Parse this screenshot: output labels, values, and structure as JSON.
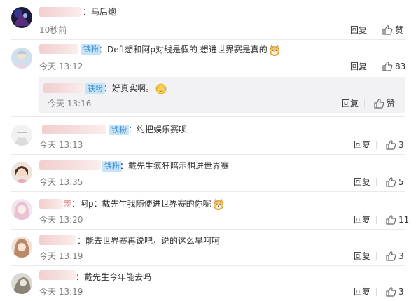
{
  "comments": [
    {
      "text": "马后炮",
      "time": "10秒前",
      "reply": "回复",
      "like": "赞"
    },
    {
      "badge": "铁粉",
      "text": "Deft想和阿p对线是假的 想进世界赛是真的",
      "time": "今天 13:12",
      "reply": "回复",
      "like": "83"
    },
    {
      "badge": "铁粉",
      "text": "好真实啊。",
      "time": "今天 13:16",
      "reply": "回复",
      "like": "赞"
    },
    {
      "badge": "铁粉",
      "text": "约把娱乐赛呗",
      "time": "今天 13:13",
      "reply": "回复",
      "like": "3"
    },
    {
      "badge": "铁粉",
      "text": "戴先生疯狂暗示想进世界赛",
      "time": "今天 13:35",
      "reply": "回复",
      "like": "5"
    },
    {
      "name_tail": "羡",
      "text": "阿p：戴先生我随便进世界赛的你呢",
      "time": "今天 13:20",
      "reply": "回复",
      "like": "11"
    },
    {
      "text": "能去世界赛再说吧，说的这么早呵呵",
      "time": "今天 13:19",
      "reply": "回复",
      "like": "3"
    },
    {
      "text": "戴先生今年能去吗",
      "time": "今天 13:19",
      "reply": "回复",
      "like": "3"
    }
  ],
  "colors": {
    "badge_bg": "#c7e3f7",
    "badge_text": "#3b8fd4",
    "time": "#808080"
  },
  "icons": [
    "thumbs-up-icon",
    "doge-emoji-icon",
    "laughing-emoji-icon"
  ]
}
